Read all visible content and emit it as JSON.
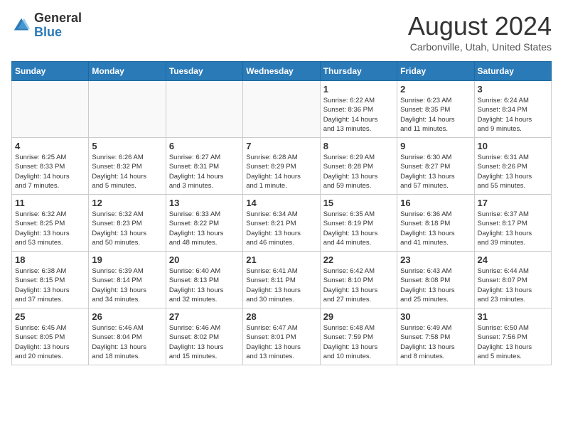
{
  "header": {
    "logo_general": "General",
    "logo_blue": "Blue",
    "month_year": "August 2024",
    "location": "Carbonville, Utah, United States"
  },
  "days_of_week": [
    "Sunday",
    "Monday",
    "Tuesday",
    "Wednesday",
    "Thursday",
    "Friday",
    "Saturday"
  ],
  "weeks": [
    [
      {
        "day": "",
        "info": ""
      },
      {
        "day": "",
        "info": ""
      },
      {
        "day": "",
        "info": ""
      },
      {
        "day": "",
        "info": ""
      },
      {
        "day": "1",
        "info": "Sunrise: 6:22 AM\nSunset: 8:36 PM\nDaylight: 14 hours\nand 13 minutes."
      },
      {
        "day": "2",
        "info": "Sunrise: 6:23 AM\nSunset: 8:35 PM\nDaylight: 14 hours\nand 11 minutes."
      },
      {
        "day": "3",
        "info": "Sunrise: 6:24 AM\nSunset: 8:34 PM\nDaylight: 14 hours\nand 9 minutes."
      }
    ],
    [
      {
        "day": "4",
        "info": "Sunrise: 6:25 AM\nSunset: 8:33 PM\nDaylight: 14 hours\nand 7 minutes."
      },
      {
        "day": "5",
        "info": "Sunrise: 6:26 AM\nSunset: 8:32 PM\nDaylight: 14 hours\nand 5 minutes."
      },
      {
        "day": "6",
        "info": "Sunrise: 6:27 AM\nSunset: 8:31 PM\nDaylight: 14 hours\nand 3 minutes."
      },
      {
        "day": "7",
        "info": "Sunrise: 6:28 AM\nSunset: 8:29 PM\nDaylight: 14 hours\nand 1 minute."
      },
      {
        "day": "8",
        "info": "Sunrise: 6:29 AM\nSunset: 8:28 PM\nDaylight: 13 hours\nand 59 minutes."
      },
      {
        "day": "9",
        "info": "Sunrise: 6:30 AM\nSunset: 8:27 PM\nDaylight: 13 hours\nand 57 minutes."
      },
      {
        "day": "10",
        "info": "Sunrise: 6:31 AM\nSunset: 8:26 PM\nDaylight: 13 hours\nand 55 minutes."
      }
    ],
    [
      {
        "day": "11",
        "info": "Sunrise: 6:32 AM\nSunset: 8:25 PM\nDaylight: 13 hours\nand 53 minutes."
      },
      {
        "day": "12",
        "info": "Sunrise: 6:32 AM\nSunset: 8:23 PM\nDaylight: 13 hours\nand 50 minutes."
      },
      {
        "day": "13",
        "info": "Sunrise: 6:33 AM\nSunset: 8:22 PM\nDaylight: 13 hours\nand 48 minutes."
      },
      {
        "day": "14",
        "info": "Sunrise: 6:34 AM\nSunset: 8:21 PM\nDaylight: 13 hours\nand 46 minutes."
      },
      {
        "day": "15",
        "info": "Sunrise: 6:35 AM\nSunset: 8:19 PM\nDaylight: 13 hours\nand 44 minutes."
      },
      {
        "day": "16",
        "info": "Sunrise: 6:36 AM\nSunset: 8:18 PM\nDaylight: 13 hours\nand 41 minutes."
      },
      {
        "day": "17",
        "info": "Sunrise: 6:37 AM\nSunset: 8:17 PM\nDaylight: 13 hours\nand 39 minutes."
      }
    ],
    [
      {
        "day": "18",
        "info": "Sunrise: 6:38 AM\nSunset: 8:15 PM\nDaylight: 13 hours\nand 37 minutes."
      },
      {
        "day": "19",
        "info": "Sunrise: 6:39 AM\nSunset: 8:14 PM\nDaylight: 13 hours\nand 34 minutes."
      },
      {
        "day": "20",
        "info": "Sunrise: 6:40 AM\nSunset: 8:13 PM\nDaylight: 13 hours\nand 32 minutes."
      },
      {
        "day": "21",
        "info": "Sunrise: 6:41 AM\nSunset: 8:11 PM\nDaylight: 13 hours\nand 30 minutes."
      },
      {
        "day": "22",
        "info": "Sunrise: 6:42 AM\nSunset: 8:10 PM\nDaylight: 13 hours\nand 27 minutes."
      },
      {
        "day": "23",
        "info": "Sunrise: 6:43 AM\nSunset: 8:08 PM\nDaylight: 13 hours\nand 25 minutes."
      },
      {
        "day": "24",
        "info": "Sunrise: 6:44 AM\nSunset: 8:07 PM\nDaylight: 13 hours\nand 23 minutes."
      }
    ],
    [
      {
        "day": "25",
        "info": "Sunrise: 6:45 AM\nSunset: 8:05 PM\nDaylight: 13 hours\nand 20 minutes."
      },
      {
        "day": "26",
        "info": "Sunrise: 6:46 AM\nSunset: 8:04 PM\nDaylight: 13 hours\nand 18 minutes."
      },
      {
        "day": "27",
        "info": "Sunrise: 6:46 AM\nSunset: 8:02 PM\nDaylight: 13 hours\nand 15 minutes."
      },
      {
        "day": "28",
        "info": "Sunrise: 6:47 AM\nSunset: 8:01 PM\nDaylight: 13 hours\nand 13 minutes."
      },
      {
        "day": "29",
        "info": "Sunrise: 6:48 AM\nSunset: 7:59 PM\nDaylight: 13 hours\nand 10 minutes."
      },
      {
        "day": "30",
        "info": "Sunrise: 6:49 AM\nSunset: 7:58 PM\nDaylight: 13 hours\nand 8 minutes."
      },
      {
        "day": "31",
        "info": "Sunrise: 6:50 AM\nSunset: 7:56 PM\nDaylight: 13 hours\nand 5 minutes."
      }
    ]
  ]
}
